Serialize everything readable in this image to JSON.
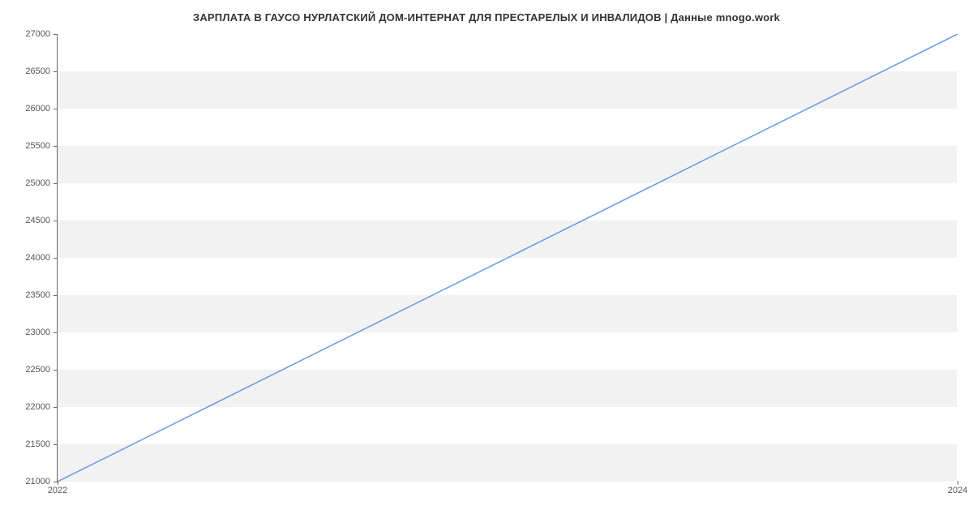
{
  "chart_data": {
    "type": "line",
    "title": "ЗАРПЛАТА В ГАУСО НУРЛАТСКИЙ ДОМ-ИНТЕРНАТ ДЛЯ ПРЕСТАРЕЛЫХ И ИНВАЛИДОВ | Данные mnogo.work",
    "x": [
      2022,
      2024
    ],
    "values": [
      21000,
      27000
    ],
    "xlabel": "",
    "ylabel": "",
    "xlim": [
      2022,
      2024
    ],
    "ylim": [
      21000,
      27000
    ],
    "y_ticks": [
      21000,
      21500,
      22000,
      22500,
      23000,
      23500,
      24000,
      24500,
      25000,
      25500,
      26000,
      26500,
      27000
    ],
    "x_ticks": [
      2022,
      2024
    ],
    "line_color": "#6699e8",
    "band_color": "#f2f2f2"
  }
}
